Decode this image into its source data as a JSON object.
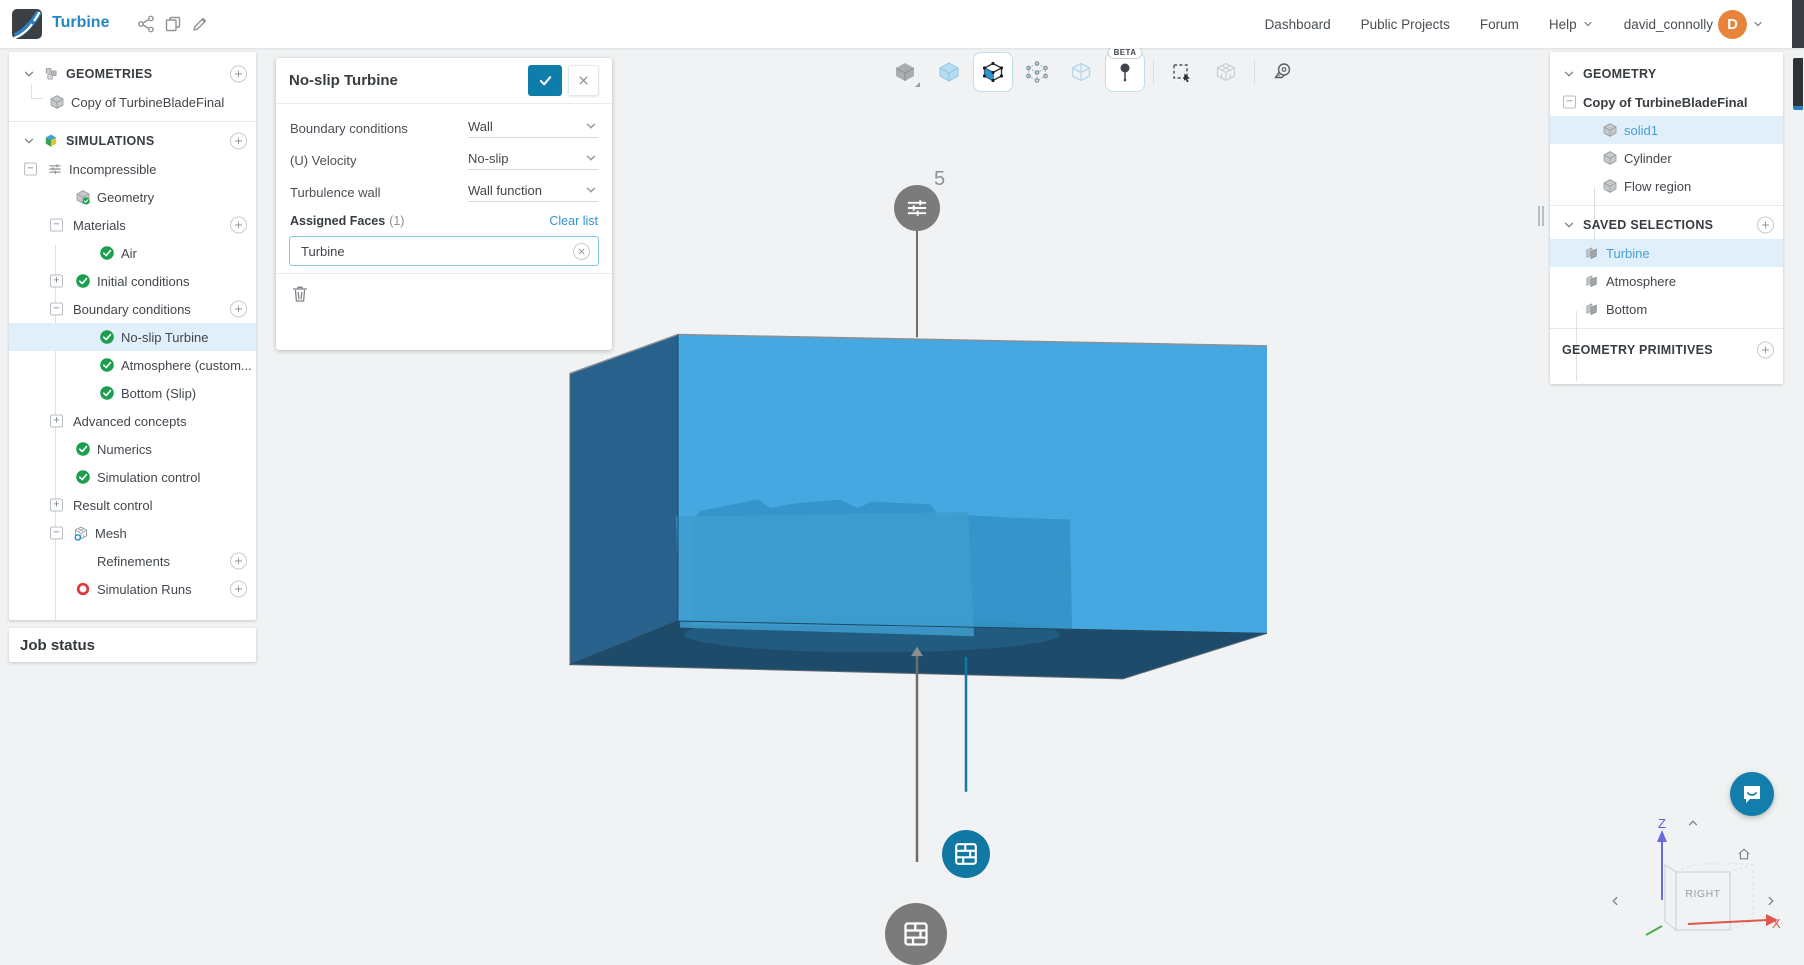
{
  "header": {
    "title": "Turbine",
    "nav_dashboard": "Dashboard",
    "nav_public_projects": "Public Projects",
    "nav_forum": "Forum",
    "help": "Help",
    "username": "david_connolly",
    "avatar_letter": "D",
    "icons": [
      "share-icon",
      "copy-icon",
      "pencil-icon"
    ]
  },
  "sidebar": {
    "rows": [
      {
        "label": "GEOMETRIES",
        "icon": "cube-stack-icon"
      },
      {
        "label": "Copy of TurbineBladeFinal",
        "icon": "cube-icon"
      },
      {
        "label": "SIMULATIONS",
        "icon": "simulation-cubes-icon"
      },
      {
        "label": "Incompressible",
        "icon": "tune-icon"
      },
      {
        "label": "Geometry",
        "icon": "cube-check-icon"
      },
      {
        "label": "Materials"
      },
      {
        "label": "Air",
        "icon": "check-circle-icon"
      },
      {
        "label": "Initial conditions",
        "icon": "check-circle-icon"
      },
      {
        "label": "Boundary conditions"
      },
      {
        "label": "No-slip Turbine",
        "icon": "check-circle-icon",
        "selected": true
      },
      {
        "label": "Atmosphere (custom...",
        "icon": "check-circle-icon"
      },
      {
        "label": "Bottom (Slip)",
        "icon": "check-circle-icon"
      },
      {
        "label": "Advanced concepts"
      },
      {
        "label": "Numerics",
        "icon": "check-circle-icon"
      },
      {
        "label": "Simulation control",
        "icon": "check-circle-icon"
      },
      {
        "label": "Result control"
      },
      {
        "label": "Mesh",
        "icon": "mesh-icon"
      },
      {
        "label": "Refinements"
      },
      {
        "label": "Simulation Runs",
        "icon": "status-ring-icon"
      }
    ],
    "job_status": "Job status"
  },
  "panel": {
    "title": "No-slip Turbine",
    "fields": [
      {
        "label": "Boundary conditions",
        "value": "Wall"
      },
      {
        "label": "(U) Velocity",
        "value": "No-slip"
      },
      {
        "label": "Turbulence wall",
        "value": "Wall function"
      }
    ],
    "assigned_faces_label": "Assigned Faces",
    "assigned_faces_count": "(1)",
    "clear_list": "Clear list",
    "assignment": "Turbine"
  },
  "toolbar": {
    "beta_badge": "BETA",
    "icons": [
      "cube-solid-icon",
      "cube-shaded-icon",
      "cube-vertices-icon",
      "cube-nodes-icon",
      "cube-wireframe-icon",
      "probe-pin-icon",
      "marquee-select-icon",
      "mesh-quality-icon",
      "measure-tape-icon"
    ]
  },
  "viewport": {
    "refinement_pin_count": "5",
    "cube_face": "RIGHT",
    "axis_z": "Z",
    "axis_x": "X"
  },
  "right_panel": {
    "geometry_header": "GEOMETRY",
    "geometry_root": "Copy of TurbineBladeFinal",
    "geometry_items": [
      {
        "label": "solid1",
        "selected": true
      },
      {
        "label": "Cylinder"
      },
      {
        "label": "Flow region"
      }
    ],
    "saved_selections_header": "SAVED SELECTIONS",
    "saved_selections": [
      {
        "label": "Turbine",
        "selected": true
      },
      {
        "label": "Atmosphere"
      },
      {
        "label": "Bottom"
      }
    ],
    "primitives_header": "GEOMETRY PRIMITIVES"
  },
  "colors": {
    "accent_blue": "#2e95d3",
    "selection_bg": "#e0eff9",
    "confirm_button": "#0f7dac",
    "box_front": "#45a8e1",
    "box_side": "#27618c",
    "box_bottom": "#1d4b69",
    "pin_gray": "#7b7b7b",
    "pin_blue": "#1177a3",
    "status_green": "#1c9e4f",
    "status_red": "#df3b3b",
    "avatar_orange": "#e8833a"
  }
}
